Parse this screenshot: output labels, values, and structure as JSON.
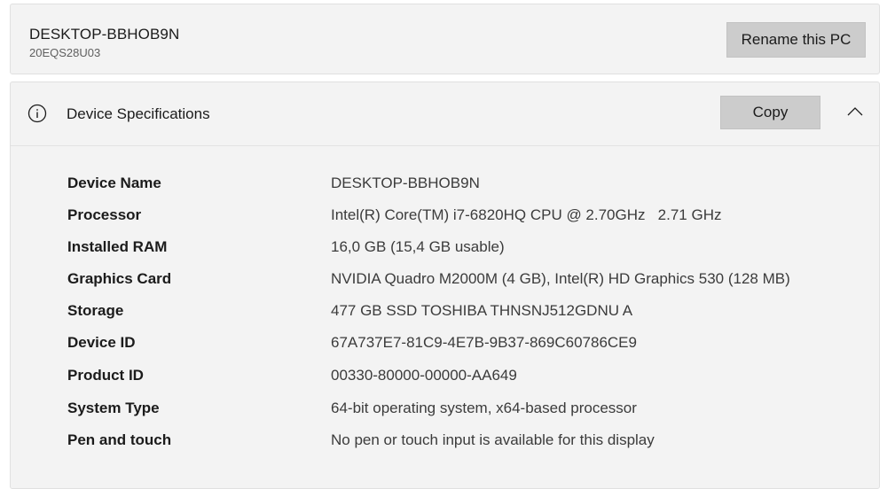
{
  "device": {
    "name": "DESKTOP-BBHOB9N",
    "model": "20EQS28U03",
    "rename_label": "Rename this PC"
  },
  "specs_section": {
    "title": "Device Specifications",
    "copy_label": "Copy",
    "info_icon": "info-circle-icon",
    "collapse_icon": "chevron-up-icon",
    "rows": [
      {
        "label": "Device Name",
        "value": "DESKTOP-BBHOB9N"
      },
      {
        "label": "Processor",
        "value": "Intel(R) Core(TM) i7-6820HQ CPU @ 2.70GHz   2.71 GHz"
      },
      {
        "label": "Installed RAM",
        "value": "16,0 GB (15,4 GB usable)"
      },
      {
        "label": "Graphics Card",
        "value": "NVIDIA Quadro M2000M (4 GB), Intel(R) HD Graphics 530 (128 MB)"
      },
      {
        "label": "Storage",
        "value": "477 GB SSD TOSHIBA THNSNJ512GDNU A"
      },
      {
        "label": "Device ID",
        "value": "67A737E7-81C9-4E7B-9B37-869C60786CE9"
      },
      {
        "label": "Product ID",
        "value": "00330-80000-00000-AA649"
      },
      {
        "label": "System Type",
        "value": "64-bit operating system, x64-based processor"
      },
      {
        "label": "Pen and touch",
        "value": "No pen or touch input is available for this display"
      }
    ]
  },
  "colors": {
    "card_background": "#f3f3f3",
    "button_background": "#cccccc",
    "label_text": "#1b1b1b",
    "value_text": "#3b3b3b"
  }
}
